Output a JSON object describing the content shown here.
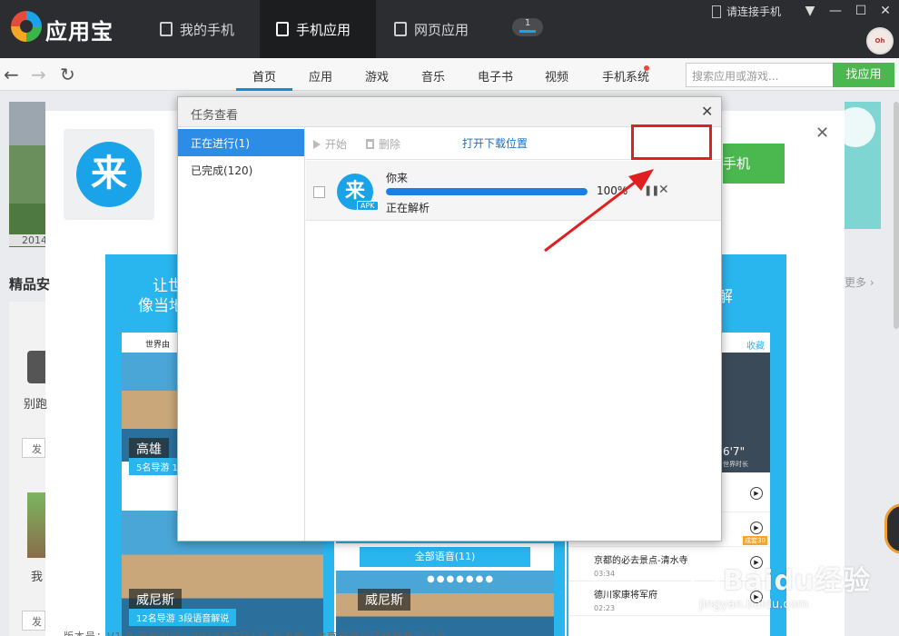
{
  "app": {
    "brand": "应用宝"
  },
  "top_tabs": [
    {
      "label": "我的手机"
    },
    {
      "label": "手机应用"
    },
    {
      "label": "网页应用"
    }
  ],
  "download_badge": "1",
  "connect_phone": "请连接手机",
  "avatar_text": "Oh Shit!?",
  "nav": {
    "items": [
      "首页",
      "应用",
      "游戏",
      "音乐",
      "电子书",
      "视频",
      "手机系统"
    ],
    "search_placeholder": "搜索应用或游戏...",
    "search_button": "找应用"
  },
  "background": {
    "banner_year": "2014",
    "section_title": "精品安",
    "more_link": "更多",
    "install_button": "手机",
    "side_app1_name": "别跑",
    "side_app1_btn": "发",
    "side_app2_name": "我",
    "side_app2_btn": "发",
    "app_icon_glyph": "来",
    "bottom_info": "版本号：V1.0    更新时间：2014年7月1日    开发商：北京云游互联科技有限公司",
    "screenshots": {
      "shot1_title_line1": "让世",
      "shot1_title_line2": "像当地",
      "shot1_app_header": "世界由",
      "shot1_city": "高雄",
      "shot1_tag": "5名导游  1",
      "shot1_city2": "威尼斯",
      "shot1_tag2": "12名导游  3段语音解说",
      "shot2_strip": "全部语音(11)",
      "shot2_dots": "●●●●●●●",
      "shot2_city": "威尼斯",
      "shot3_title": "解",
      "shot3_fav": "收藏",
      "shot3_height": "6'7\"",
      "shot3_height_sub": "世界时长",
      "shot3_item1": "京都的必去景点-清水寺",
      "shot3_item1_time": "03:34",
      "shot3_item2": "德川家康将军府",
      "shot3_item2_time": "02:23",
      "shot3_badge": "成套30"
    }
  },
  "watermark": {
    "text": "Baidu经验",
    "sub": "jingyan.baidu.com"
  },
  "dialog": {
    "title": "任务查看",
    "tabs": [
      {
        "label": "正在进行(1)"
      },
      {
        "label": "已完成(120)"
      }
    ],
    "toolbar": {
      "start": "开始",
      "delete": "删除",
      "open_location": "打开下载位置"
    },
    "task": {
      "name": "你来",
      "icon_glyph": "来",
      "icon_tag": "APK",
      "progress": 1.0,
      "percent_text": "100%",
      "status": "正在解析"
    }
  },
  "colors": {
    "accent": "#2d8ce6",
    "green": "#4bb84f",
    "highlight": "#e02020"
  }
}
